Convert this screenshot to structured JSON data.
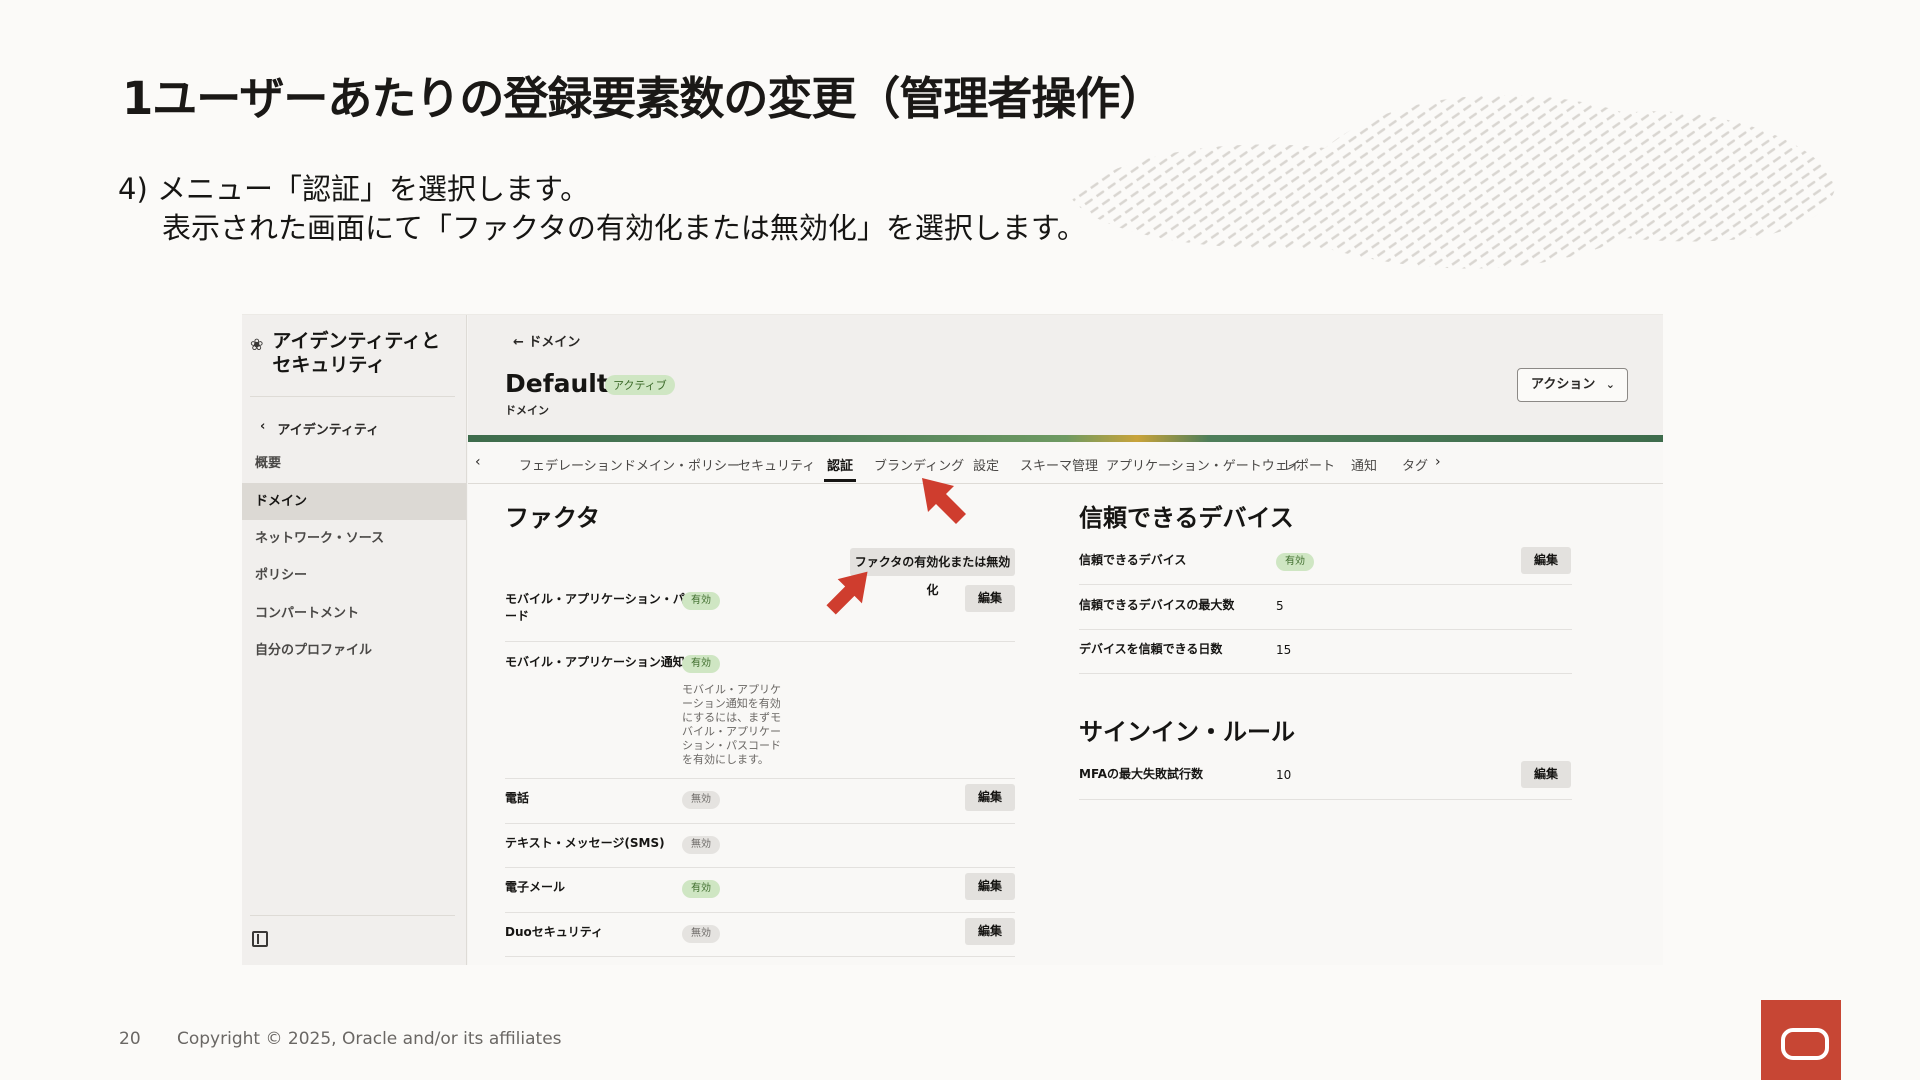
{
  "slide": {
    "title": "1ユーザーあたりの登録要素数の変更（管理者操作）",
    "step_line1": "4) メニュー「認証」を選択します。",
    "step_line2": "表示された画面にて「ファクタの有効化または無効化」を選択します。",
    "page_number": "20",
    "copyright": "Copyright © 2025, Oracle and/or its affiliates"
  },
  "sidebar": {
    "title": "アイデンティティと\nセキュリティ",
    "title_line1": "アイデンティティと",
    "title_line2": "セキュリティ",
    "icon": "identity-cluster-icon",
    "back_label": "アイデンティティ",
    "items": [
      {
        "label": "概要",
        "active": false
      },
      {
        "label": "ドメイン",
        "active": true
      },
      {
        "label": "ネットワーク・ソース",
        "active": false
      },
      {
        "label": "ポリシー",
        "active": false
      },
      {
        "label": "コンパートメント",
        "active": false
      },
      {
        "label": "自分のプロファイル",
        "active": false
      }
    ]
  },
  "header": {
    "back_label": "← ドメイン",
    "domain_name": "Default",
    "status_badge": "アクティブ",
    "subtitle": "ドメイン",
    "action_label": "アクション"
  },
  "tabs": {
    "items": [
      "フェデレーション",
      "ドメイン・ポリシー",
      "セキュリティ",
      "認証",
      "ブランディング",
      "設定",
      "スキーマ管理",
      "アプリケーション・ゲートウェイ",
      "レポート",
      "通知",
      "タグ"
    ],
    "selected": "認証"
  },
  "factors": {
    "heading": "ファクタ",
    "toggle_button": "ファクタの有効化または無効化",
    "rows": [
      {
        "label": "モバイル・アプリケーション・パスコード",
        "label_line1": "モバイル・アプリケーション・パスコ",
        "label_line2": "ード",
        "status": "有効",
        "edit": "編集"
      },
      {
        "label": "モバイル・アプリケーション通知",
        "status": "有効",
        "note": "モバイル・アプリケーション通知を有効にするには、まずモバイル・アプリケーション・パスコードを有効にします。"
      },
      {
        "label": "電話",
        "status": "無効",
        "edit": "編集"
      },
      {
        "label": "テキスト・メッセージ(SMS)",
        "status": "無効"
      },
      {
        "label": "電子メール",
        "status": "有効",
        "edit": "編集"
      },
      {
        "label": "Duoセキュリティ",
        "status": "無効",
        "edit": "編集"
      }
    ]
  },
  "trusted_devices": {
    "heading": "信頼できるデバイス",
    "rows": [
      {
        "label": "信頼できるデバイス",
        "value": "有効",
        "edit": "編集"
      },
      {
        "label": "信頼できるデバイスの最大数",
        "value": "5"
      },
      {
        "label": "デバイスを信頼できる日数",
        "value": "15"
      }
    ]
  },
  "signin_rules": {
    "heading": "サインイン・ルール",
    "rows": [
      {
        "label": "MFAの最大失敗試行数",
        "value": "10",
        "edit": "編集"
      }
    ]
  },
  "colors": {
    "accent_red": "#c74634",
    "annotation_arrow": "#cf3d2e",
    "enabled_badge": "#cfe6c3",
    "disabled_badge": "#e5e3e0"
  }
}
